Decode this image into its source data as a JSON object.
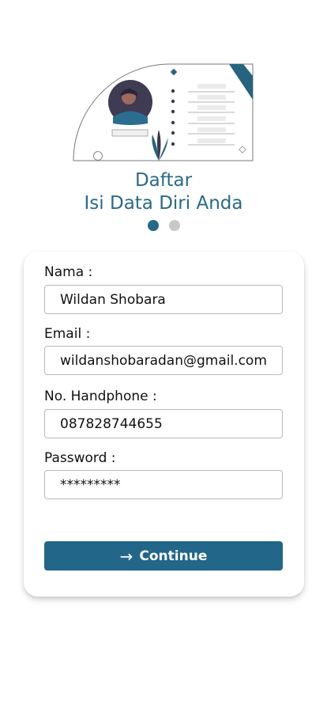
{
  "header": {
    "title": "Daftar",
    "subtitle": "Isi Data Diri Anda"
  },
  "stepper": {
    "total_steps": 2,
    "current_step": 1
  },
  "form": {
    "name_label": "Nama :",
    "name_value": "Wildan Shobara",
    "email_label": "Email :",
    "email_value": "wildanshobaradan@gmail.com",
    "phone_label": "No. Handphone :",
    "phone_value": "087828744655",
    "password_label": "Password :",
    "password_value": "*********"
  },
  "actions": {
    "continue_icon": "→",
    "continue_label": "Continue"
  },
  "colors": {
    "primary": "#22668a",
    "title": "#2a6a88",
    "dot_inactive": "#c8c8c8"
  }
}
